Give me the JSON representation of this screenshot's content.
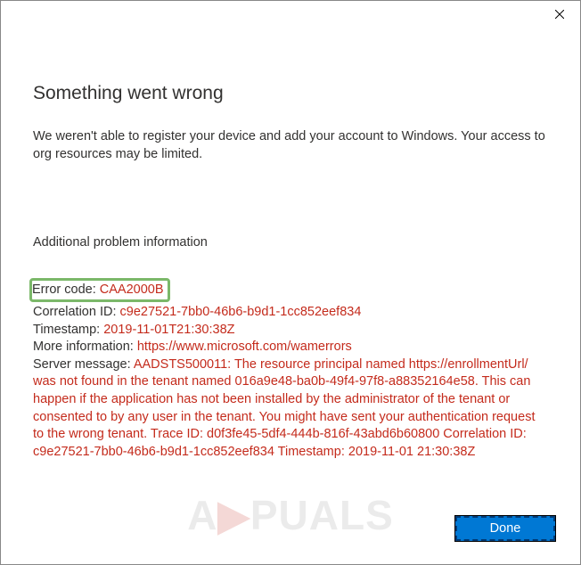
{
  "dialog": {
    "title": "Something went wrong",
    "description": "We weren't able to register your device and add your account to Windows. Your access to org resources may be limited.",
    "subheading": "Additional problem information",
    "error_code_label": "Error code: ",
    "error_code_value": "CAA2000B",
    "correlation_label": "Correlation ID: ",
    "correlation_value": "c9e27521-7bb0-46b6-b9d1-1cc852eef834",
    "timestamp_label": "Timestamp: ",
    "timestamp_value": "2019-11-01T21:30:38Z",
    "more_info_label": "More information: ",
    "more_info_value": "https://www.microsoft.com/wamerrors",
    "server_msg_label": "Server message: ",
    "server_msg_value": "AADSTS500011: The resource principal named https://enrollmentUrl/ was not found in the tenant named 016a9e48-ba0b-49f4-97f8-a88352164e58. This can happen if the application has not been installed by the administrator of the tenant or consented to by any user in the tenant. You might have sent your authentication request to the wrong tenant. Trace ID: d0f3fe45-5df4-444b-816f-43abd6b60800 Correlation ID: c9e27521-7bb0-46b6-b9d1-1cc852eef834 Timestamp: 2019-11-01 21:30:38Z",
    "done_button": "Done"
  },
  "watermark": {
    "prefix": "A",
    "accent": "▶",
    "suffix": "PUALS"
  }
}
